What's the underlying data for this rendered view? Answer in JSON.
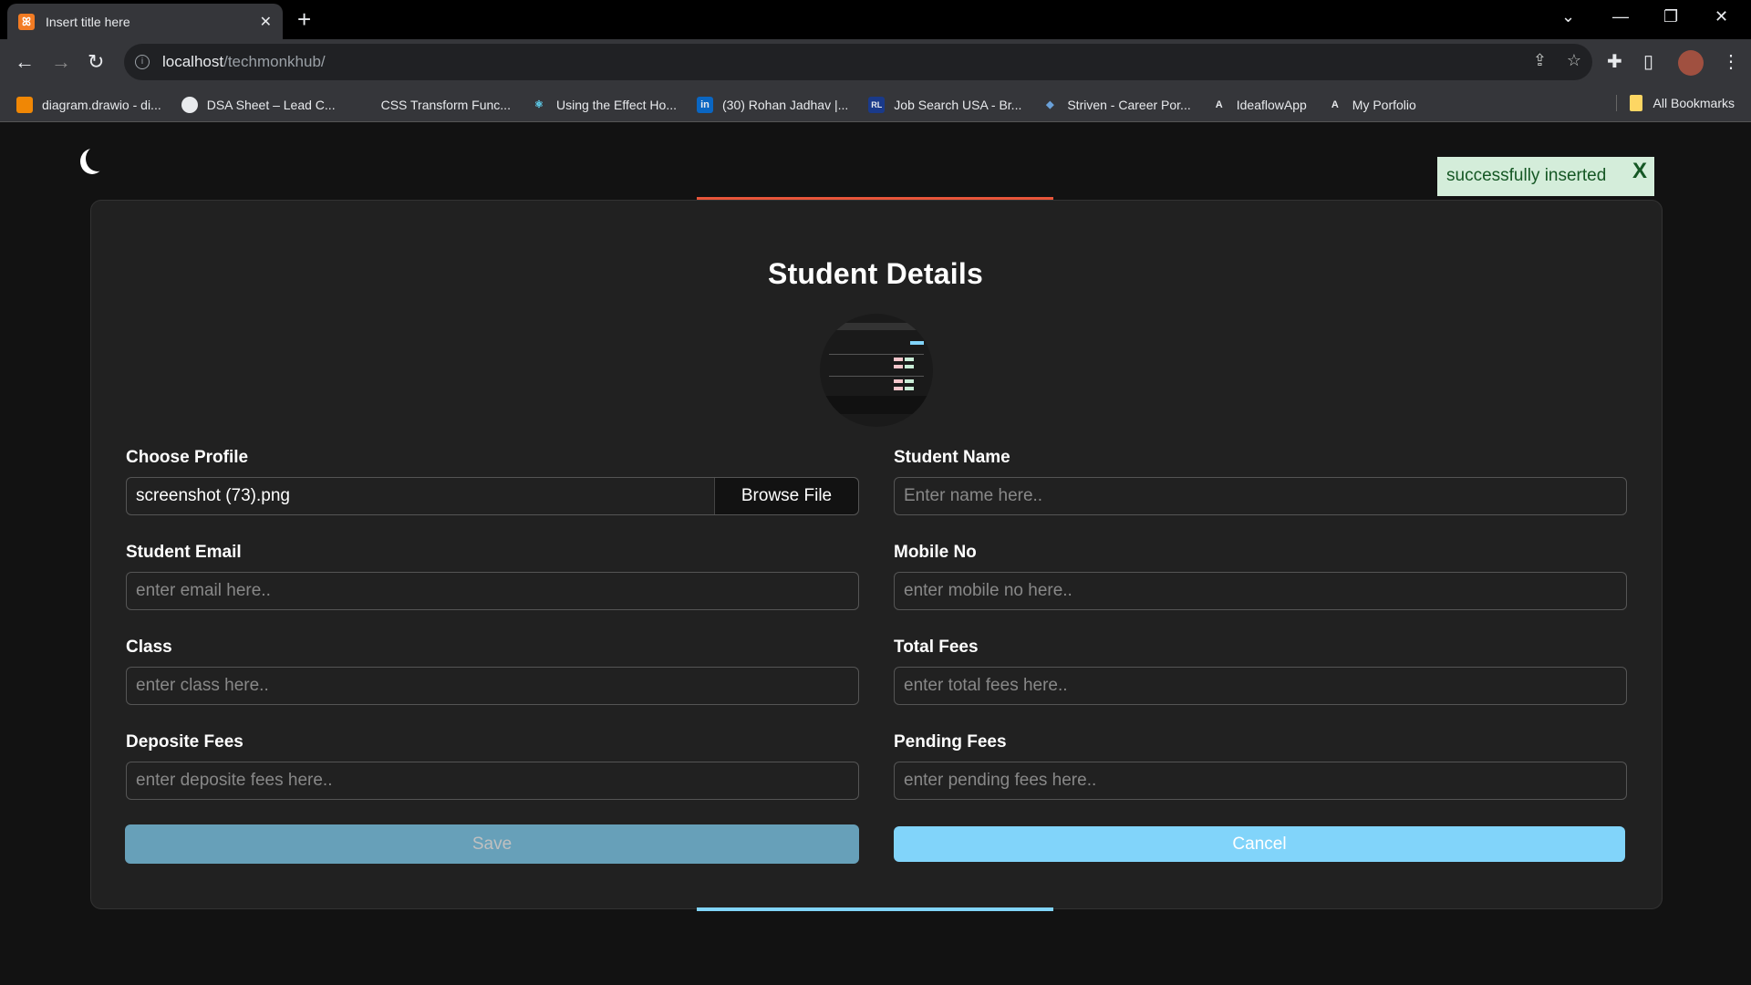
{
  "browser": {
    "tab_title": "Insert title here",
    "url_host": "localhost",
    "url_path": "/techmonkhub/",
    "bookmarks": [
      {
        "label": "diagram.drawio - di...",
        "color": "#f08705"
      },
      {
        "label": "DSA Sheet – Lead C...",
        "color": "#e8eaed"
      },
      {
        "label": "CSS Transform Func...",
        "color": "#35363a"
      },
      {
        "label": "Using the Effect Ho...",
        "color": "#61dafb"
      },
      {
        "label": "(30) Rohan Jadhav |...",
        "color": "#0a66c2"
      },
      {
        "label": "Job Search USA - Br...",
        "color": "#1a3a8a"
      },
      {
        "label": "Striven - Career Por...",
        "color": "#6aa0d8"
      },
      {
        "label": "IdeaflowApp",
        "color": "#111"
      },
      {
        "label": "My Porfolio",
        "color": "#111"
      }
    ],
    "bookmark_icon_text": {
      "linkedin": "in",
      "rl": "RL",
      "angular": "A"
    },
    "all_bookmarks": "All Bookmarks"
  },
  "toast": {
    "message": "successfully inserted",
    "close": "X"
  },
  "form": {
    "title": "Student Details",
    "fields": {
      "profile": {
        "label": "Choose Profile",
        "value": "screenshot (73).png",
        "button": "Browse File"
      },
      "name": {
        "label": "Student Name",
        "placeholder": "Enter name here.."
      },
      "email": {
        "label": "Student Email",
        "placeholder": "enter email here.."
      },
      "mobile": {
        "label": "Mobile No",
        "placeholder": "enter mobile no here.."
      },
      "class": {
        "label": "Class",
        "placeholder": "enter class here.."
      },
      "total": {
        "label": "Total Fees",
        "placeholder": "enter total fees here.."
      },
      "deposite": {
        "label": "Deposite Fees",
        "placeholder": "enter deposite fees here.."
      },
      "pending": {
        "label": "Pending Fees",
        "placeholder": "enter pending fees here.."
      }
    },
    "save": "Save",
    "cancel": "Cancel"
  },
  "colors": {
    "accent_top": "#e8553a",
    "accent_bottom": "#81d4fa",
    "cancel": "#81d4fa",
    "save": "#67a0b9"
  }
}
